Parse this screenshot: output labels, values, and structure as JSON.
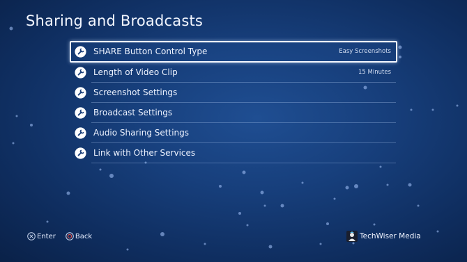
{
  "screen": {
    "title": "Sharing and Broadcasts"
  },
  "menu": {
    "items": [
      {
        "label": "SHARE Button Control Type",
        "value": "Easy Screenshots",
        "icon": "wrench-icon",
        "focused": true
      },
      {
        "label": "Length of Video Clip",
        "value": "15 Minutes",
        "icon": "wrench-icon",
        "focused": false
      },
      {
        "label": "Screenshot Settings",
        "value": "",
        "icon": "wrench-icon",
        "focused": false
      },
      {
        "label": "Broadcast Settings",
        "value": "",
        "icon": "wrench-icon",
        "focused": false
      },
      {
        "label": "Audio Sharing Settings",
        "value": "",
        "icon": "wrench-icon",
        "focused": false
      },
      {
        "label": "Link with Other Services",
        "value": "",
        "icon": "wrench-icon",
        "focused": false
      }
    ]
  },
  "footer": {
    "enter_label": "Enter",
    "enter_icon": "cross-button-icon",
    "back_label": "Back",
    "back_icon": "circle-button-icon",
    "watermark_text": "TechWiser Media"
  },
  "colors": {
    "background": "#173f7c",
    "focus_border": "#f5f8ff",
    "back_button": "#d9534f"
  }
}
